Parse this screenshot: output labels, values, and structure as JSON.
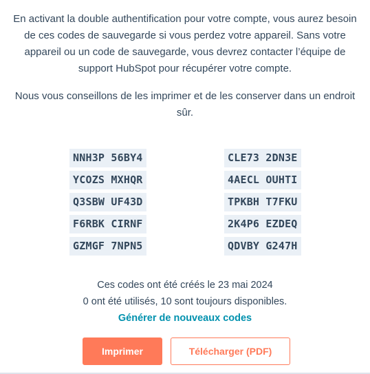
{
  "intro_text": "En activant la double authentification pour votre compte, vous aurez besoin de ces codes de sauvegarde si vous perdez votre appareil. Sans votre appareil ou un code de sauvegarde, vous devrez contacter l’équipe de support HubSpot pour récupérer votre compte.",
  "advice_text": "Nous vous conseillons de les imprimer et de les conserver dans un endroit sûr.",
  "codes": {
    "left": [
      "NNH3P 56BY4",
      "YCOZS MXHQR",
      "Q3SBW UF43D",
      "F6RBK CIRNF",
      "GZMGF 7NPN5"
    ],
    "right": [
      "CLE73 2DN3E",
      "4AECL OUHTI",
      "TPKBH T7FKU",
      "2K4P6 EZDEQ",
      "QDVBY G247H"
    ]
  },
  "meta": {
    "created_text": "Ces codes ont été créés le 23 mai 2024",
    "usage_text": "0 ont été utilisés, 10 sont toujours disponibles.",
    "regenerate_link": "Générer de nouveaux codes"
  },
  "buttons": {
    "print_label": "Imprimer",
    "download_label": "Télécharger (PDF)"
  },
  "colors": {
    "accent": "#ff7a59",
    "link": "#0091ae",
    "text": "#33475b",
    "code_bg": "#eaf0f6"
  }
}
